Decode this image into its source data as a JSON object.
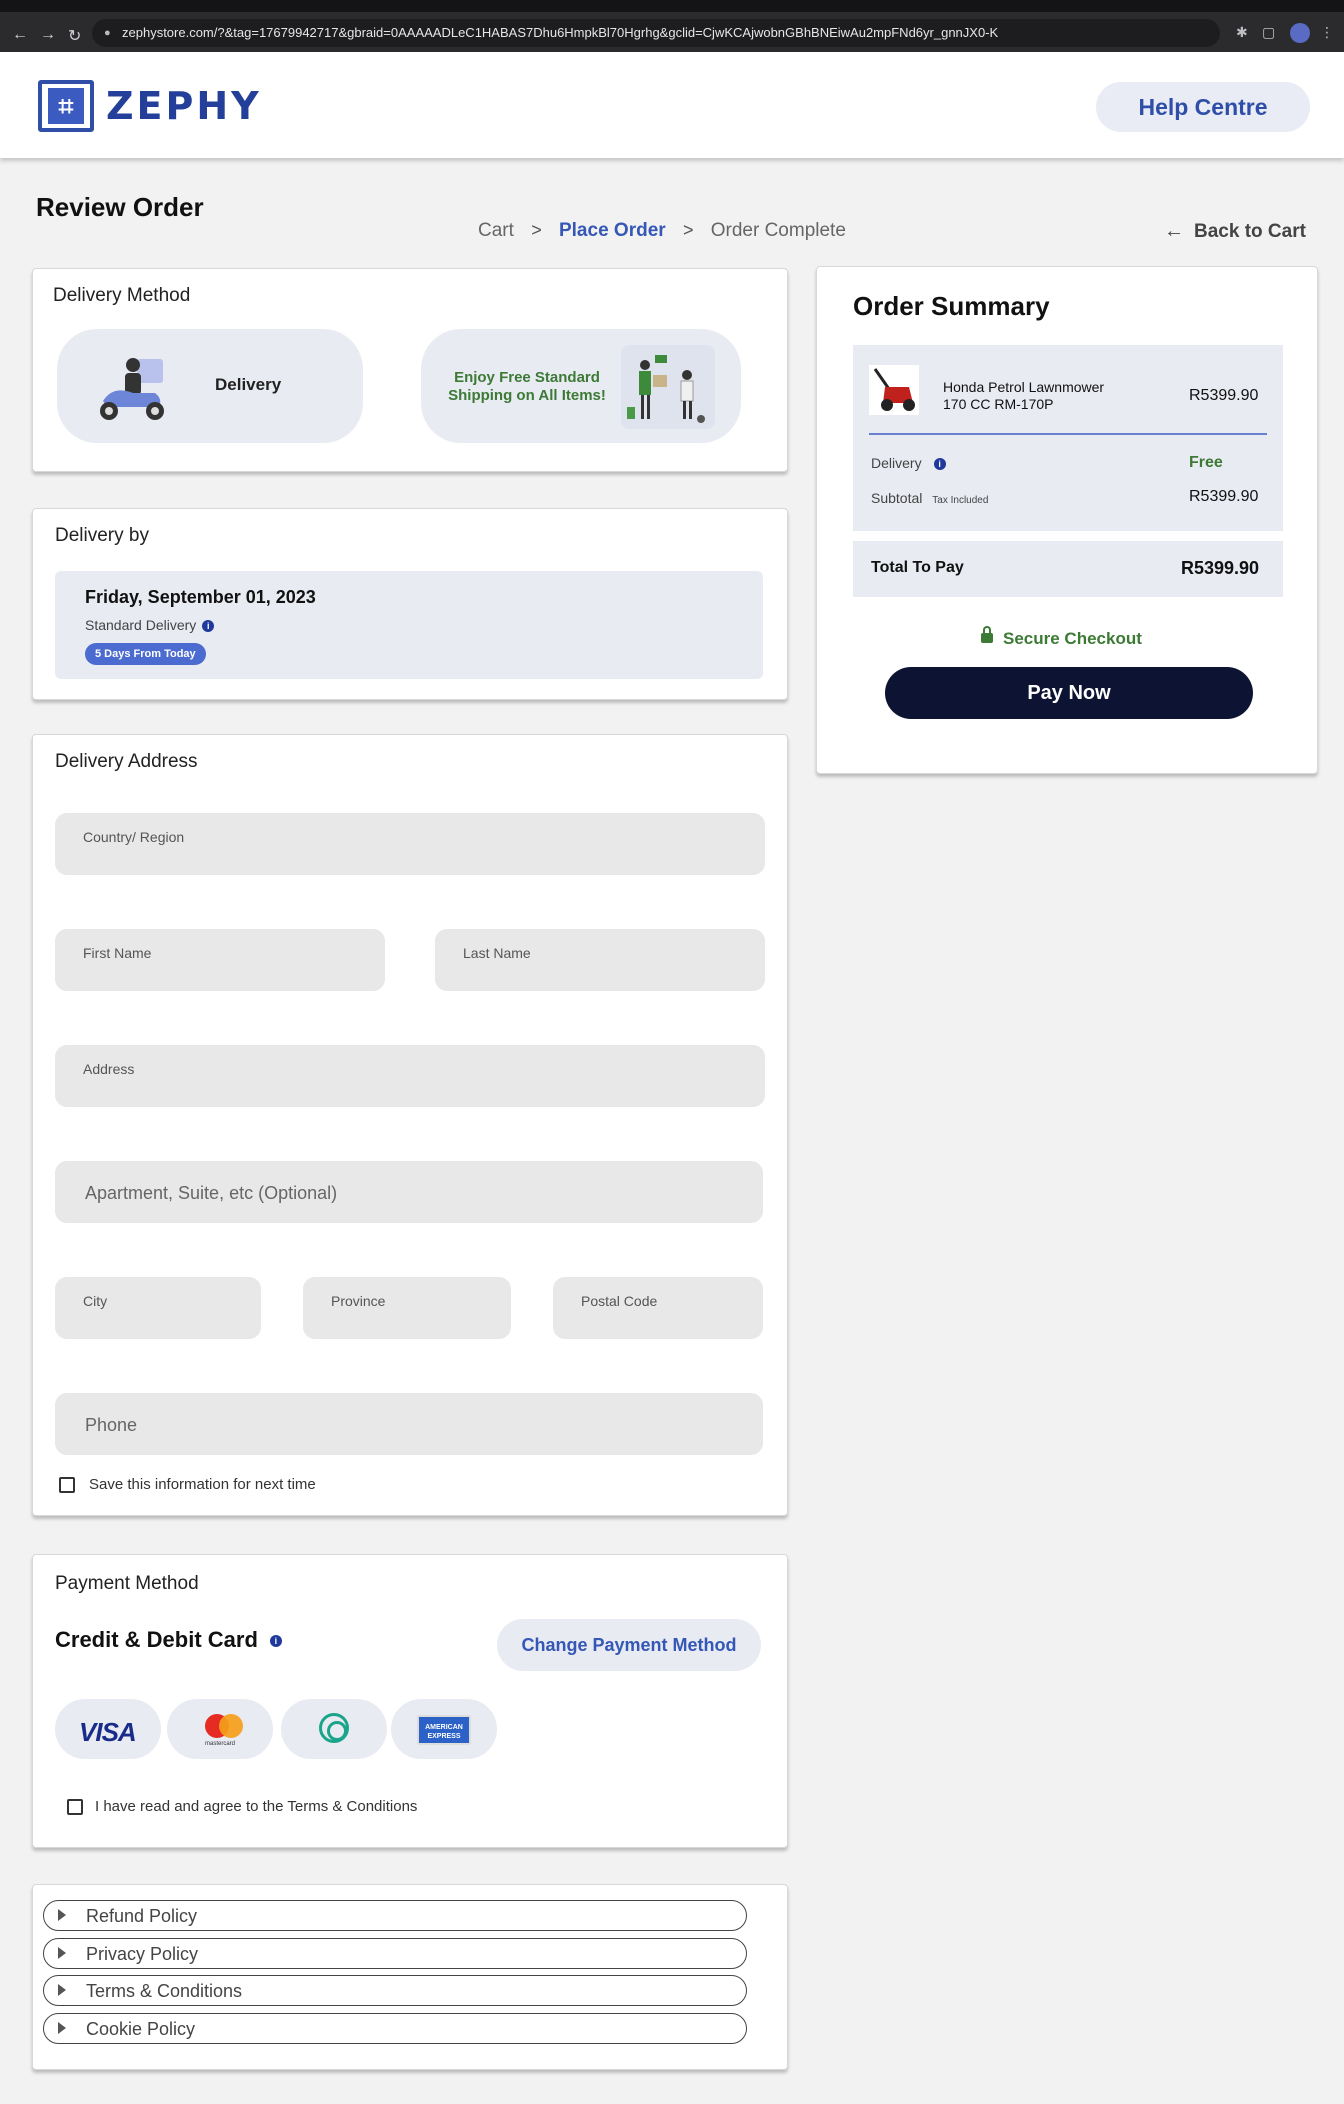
{
  "browser": {
    "url": "zephystore.com/?&tag=17679942717&gbraid=0AAAAADLeC1HABAS7Dhu6HmpkBl70Hgrhg&gclid=CjwKCAjwobnGBhBNEiwAu2mpFNd6yr_gnnJX0-K"
  },
  "header": {
    "logo_text": "ZEPHY",
    "help_label": "Help Centre"
  },
  "page": {
    "title": "Review Order",
    "breadcrumbs": [
      "Cart",
      "Place Order",
      "Order Complete"
    ],
    "back_label": "Back to Cart"
  },
  "delivery_method": {
    "title": "Delivery Method",
    "option_label": "Delivery",
    "promo_line1": "Enjoy Free Standard",
    "promo_line2": "Shipping on All Items!"
  },
  "delivery_by": {
    "title": "Delivery by",
    "date": "Friday, September 01, 2023",
    "type": "Standard Delivery",
    "eta_badge": "5 Days From Today"
  },
  "address": {
    "title": "Delivery Address",
    "country_label": "Country/ Region",
    "first_name_label": "First Name",
    "last_name_label": "Last Name",
    "address_label": "Address",
    "apartment_placeholder": "Apartment, Suite, etc (Optional)",
    "city_label": "City",
    "province_label": "Province",
    "postal_label": "Postal Code",
    "phone_placeholder": "Phone",
    "save_info_label": "Save this information for next time"
  },
  "payment": {
    "title": "Payment Method",
    "method_name": "Credit & Debit Card",
    "change_label": "Change Payment Method",
    "cards": [
      "VISA",
      "mastercard",
      "contactless",
      "AMERICAN EXPRESS"
    ],
    "terms_label": "I have read and agree to the Terms & Conditions"
  },
  "policies": [
    "Refund Policy",
    "Privacy Policy",
    "Terms & Conditions",
    "Cookie Policy"
  ],
  "summary": {
    "title": "Order Summary",
    "product_line1": "Honda Petrol Lawnmower",
    "product_line2": "170 CC RM-170P",
    "product_price": "R5399.90",
    "delivery_label": "Delivery",
    "delivery_value": "Free",
    "subtotal_label": "Subtotal",
    "subtotal_note": "Tax Included",
    "subtotal_value": "R5399.90",
    "total_label": "Total To Pay",
    "total_value": "R5399.90",
    "secure_label": "Secure Checkout",
    "pay_label": "Pay Now"
  },
  "colors": {
    "brand_blue": "#2f4ea8",
    "accent_blue": "#3557b5",
    "success_green": "#3c7a35",
    "pay_button": "#0d1433"
  }
}
